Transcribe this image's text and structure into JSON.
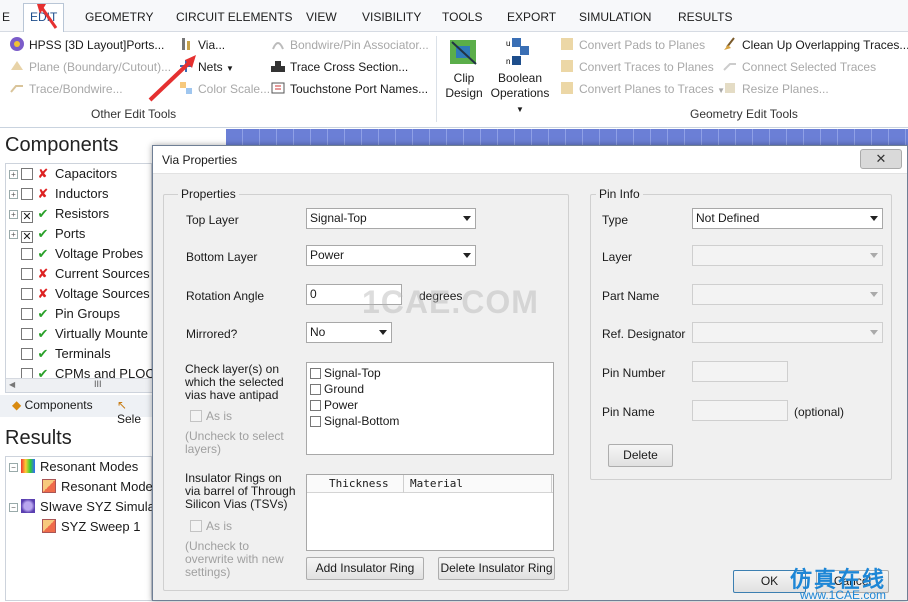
{
  "menu": {
    "partial_left": "E",
    "items": [
      "EDIT",
      "GEOMETRY",
      "CIRCUIT ELEMENTS",
      "VIEW",
      "VISIBILITY",
      "TOOLS",
      "EXPORT",
      "SIMULATION",
      "RESULTS"
    ],
    "active": "EDIT"
  },
  "ribbon": {
    "other_edit": {
      "hpss_ports": "HPSS [3D Layout]Ports...",
      "plane_boundary": "Plane (Boundary/Cutout)...",
      "trace_bondwire": "Trace/Bondwire...",
      "via": "Via...",
      "nets": "Nets",
      "color_scale": "Color Scale...",
      "bondwire_pin_assoc": "Bondwire/Pin Associator...",
      "trace_cross_section": "Trace Cross Section...",
      "touchstone_port_names": "Touchstone Port Names...",
      "group_label": "Other Edit Tools"
    },
    "geometry_edit": {
      "clip_design": [
        "Clip",
        "Design"
      ],
      "boolean_operations": [
        "Boolean",
        "Operations"
      ],
      "convert_pads_to_planes": "Convert Pads to Planes",
      "convert_traces_to_planes": "Convert Traces to Planes",
      "convert_planes_to_traces": "Convert Planes to Traces",
      "clean_up_overlapping_traces": "Clean Up Overlapping Traces...",
      "connect_selected_traces": "Connect Selected Traces",
      "resize_planes": "Resize Planes...",
      "group_label": "Geometry Edit Tools"
    }
  },
  "components_panel": {
    "title": "Components",
    "items": [
      {
        "label": "Capacitors",
        "checked": false,
        "status": "x",
        "expandable": true
      },
      {
        "label": "Inductors",
        "checked": false,
        "status": "x",
        "expandable": true
      },
      {
        "label": "Resistors",
        "checked": true,
        "status": "ok",
        "expandable": true
      },
      {
        "label": "Ports",
        "checked": true,
        "status": "ok",
        "expandable": true
      },
      {
        "label": "Voltage Probes",
        "checked": false,
        "status": "ok",
        "expandable": false
      },
      {
        "label": "Current Sources",
        "checked": false,
        "status": "x",
        "expandable": false
      },
      {
        "label": "Voltage Sources",
        "checked": false,
        "status": "x",
        "expandable": false
      },
      {
        "label": "Pin Groups",
        "checked": false,
        "status": "ok",
        "expandable": false
      },
      {
        "label": "Virtually Mounte",
        "checked": false,
        "status": "ok",
        "expandable": false
      },
      {
        "label": "Terminals",
        "checked": false,
        "status": "ok",
        "expandable": false
      },
      {
        "label": "CPMs and PLOC",
        "checked": false,
        "status": "ok",
        "expandable": false
      }
    ],
    "scroll_thumb": "III",
    "tabs": [
      "Components",
      "Sele"
    ]
  },
  "results_panel": {
    "title": "Results",
    "items": [
      {
        "label": "Resonant Modes",
        "level": 0
      },
      {
        "label": "Resonant Mode",
        "level": 1
      },
      {
        "label": "SIwave SYZ Simula",
        "level": 0
      },
      {
        "label": "SYZ Sweep 1",
        "level": 1
      }
    ]
  },
  "dialog": {
    "title": "Via Properties",
    "close_symbol": "✕",
    "properties": {
      "legend": "Properties",
      "top_layer_label": "Top Layer",
      "top_layer_value": "Signal-Top",
      "bottom_layer_label": "Bottom Layer",
      "bottom_layer_value": "Power",
      "rotation_label": "Rotation Angle",
      "rotation_value": "0",
      "rotation_unit": "degrees",
      "mirrored_label": "Mirrored?",
      "mirrored_value": "No",
      "antipad_label": "Check layer(s) on which the selected vias have antipad",
      "antipad_layers": [
        "Signal-Top",
        "Ground",
        "Power",
        "Signal-Bottom"
      ],
      "as_is_label": "As is",
      "uncheck_select_layers": "(Uncheck to select layers)",
      "insulator_label": "Insulator Rings on via barrel of Through Silicon Vias (TSVs)",
      "insulator_columns": [
        "Thickness",
        "Material"
      ],
      "as_is_label_2": "As is",
      "uncheck_overwrite": "(Uncheck to overwrite with new settings)",
      "add_insulator_ring": "Add Insulator Ring",
      "delete_insulator_ring": "Delete Insulator Ring"
    },
    "pin_info": {
      "legend": "Pin Info",
      "type_label": "Type",
      "type_value": "Not Defined",
      "layer_label": "Layer",
      "part_name_label": "Part Name",
      "ref_designator_label": "Ref. Designator",
      "pin_number_label": "Pin Number",
      "pin_name_label": "Pin Name",
      "pin_name_hint": "(optional)",
      "delete_button": "Delete"
    },
    "ok_button": "OK",
    "cancel_button": "Cancel"
  },
  "watermarks": {
    "center": "1CAE.COM",
    "brand": "仿真在线",
    "url": "www.1CAE.com"
  },
  "colors": {
    "accent": "#1e4e8c",
    "annotation_arrow": "#e53030",
    "ok_green": "#2aa02a",
    "error_red": "#d22222"
  }
}
